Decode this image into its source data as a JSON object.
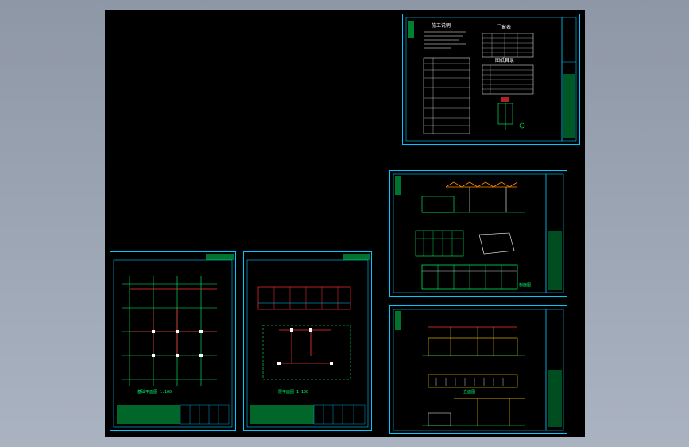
{
  "viewer": {
    "background_color": "#9aa3b2",
    "canvas_color": "#000000",
    "frame_color": "#00c8ff",
    "line_colors": {
      "grid": "#00ff66",
      "wall": "#ff3030",
      "text": "#ffffff",
      "accent": "#ffcc00"
    }
  },
  "sheets": {
    "notes": {
      "title_main": "施工说明",
      "title_table1": "门窗表",
      "title_table2": "图纸目录"
    },
    "plan1": {
      "caption": "基础平面图 1:100"
    },
    "plan2": {
      "caption": "一层平面图 1:100"
    },
    "sections": {
      "caption": "剖面图"
    },
    "elevations": {
      "caption": "立面图"
    }
  }
}
